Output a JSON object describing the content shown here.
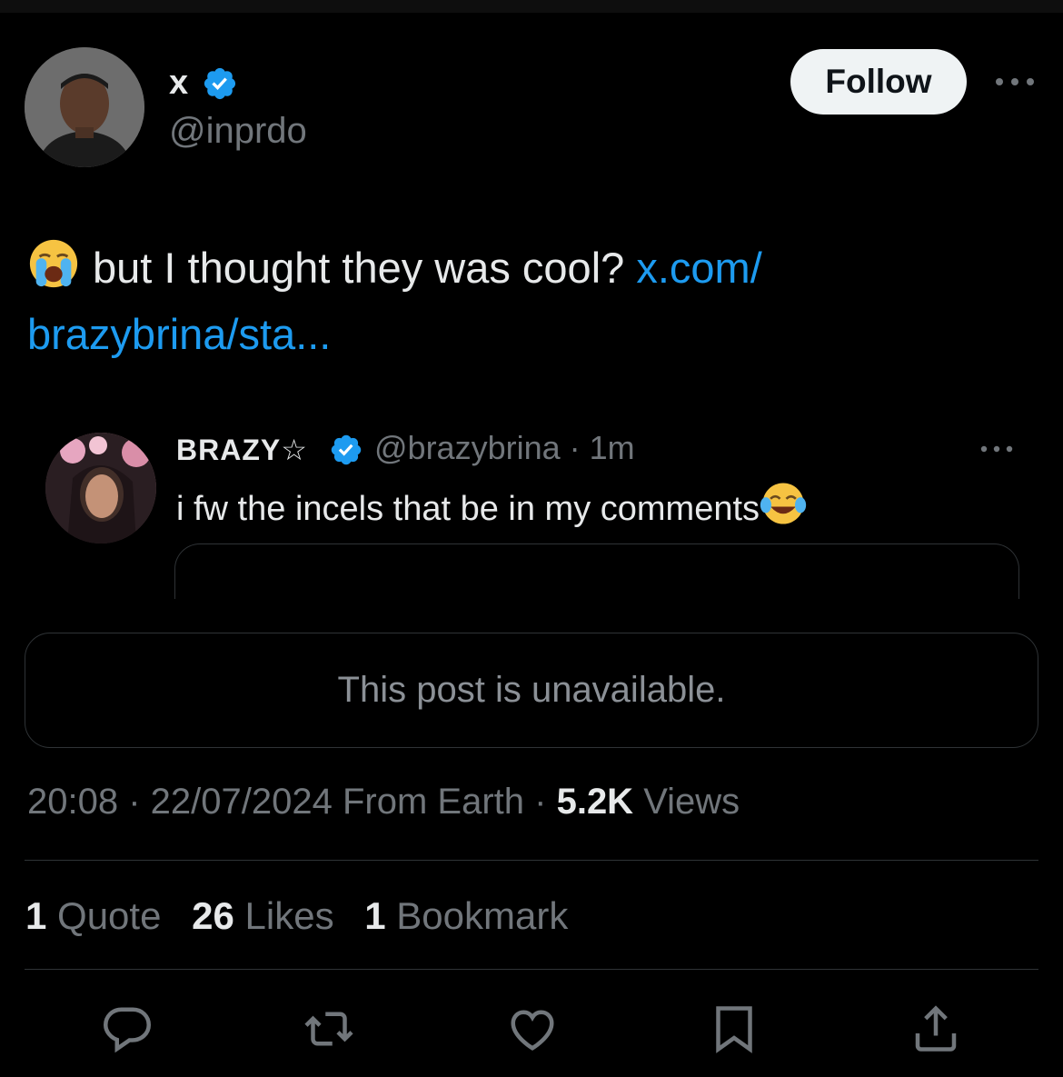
{
  "author": {
    "name": "x",
    "handle": "@inprdo",
    "verified_color": "#1d9bf0"
  },
  "follow_label": "Follow",
  "tweet": {
    "emoji": "loudly-crying-face",
    "text": "but I thought they was cool?",
    "link_part1": "x.com/",
    "link_part2": "brazybrina/sta..."
  },
  "quote": {
    "name": "BRAZY☆",
    "handle_time": "@brazybrina · 1m",
    "text": "i fw the incels that be in my comments",
    "emoji": "face-with-tears-of-joy"
  },
  "unavailable_text": "This post is unavailable.",
  "meta": {
    "time": "20:08",
    "date": "22/07/2024",
    "source": "From Earth",
    "views_count": "5.2K",
    "views_label": "Views"
  },
  "stats": {
    "quotes_count": "1",
    "quotes_label": "Quote",
    "likes_count": "26",
    "likes_label": "Likes",
    "bookmarks_count": "1",
    "bookmarks_label": "Bookmark"
  },
  "actions": [
    "reply-icon",
    "retweet-icon",
    "like-icon",
    "bookmark-icon",
    "share-icon"
  ],
  "colors": {
    "background": "#000000",
    "link": "#1d9bf0",
    "secondary_text": "#71767b",
    "border": "#2f3336"
  }
}
